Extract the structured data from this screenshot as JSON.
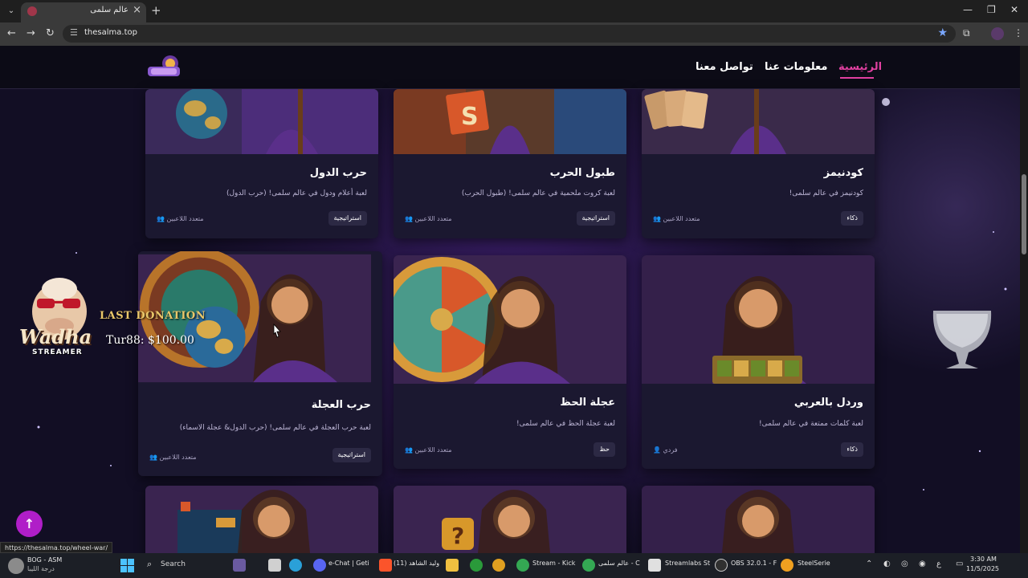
{
  "browser": {
    "tab_title": "عالم سلمى",
    "url": "thesalma.top",
    "status_url": "https://thesalma.top/wheel-war/"
  },
  "site": {
    "nav": {
      "home": "الرئيسية",
      "about": "معلومات عنا",
      "contact": "تواصل معنا"
    }
  },
  "cards": [
    {
      "title": "حرب الدول",
      "desc": "لعبة أعلام ودول في عالم سلمى! (حرب الدول)",
      "badge": "استراتيجية",
      "players": "متعدد اللاعبين"
    },
    {
      "title": "طبول الحرب",
      "desc": "لعبة كروت ملحمية في عالم سلمى! (طبول الحرب)",
      "badge": "استراتيجية",
      "players": "متعدد اللاعبين"
    },
    {
      "title": "كودنيمز",
      "desc": "كودنيمز في عالم سلمى!",
      "badge": "ذكاء",
      "players": "متعدد اللاعبين"
    },
    {
      "title": "حرب العجلة",
      "desc": "لعبة حرب العجلة في عالم سلمى! (حرب الدول& عجلة الاسماء)",
      "badge": "استراتيجية",
      "players": "متعدد اللاعبين"
    },
    {
      "title": "عجلة الحظ",
      "desc": "لعبة عجلة الحظ في عالم سلمى!",
      "badge": "حظ",
      "players": "متعدد اللاعبين"
    },
    {
      "title": "وردل بالعربي",
      "desc": "لعبة كلمات ممتعة في عالم سلمى!",
      "badge": "ذكاء",
      "players": "فردي"
    }
  ],
  "overlay": {
    "wadha": "Wadha",
    "streamer": "STREAMER",
    "last_donation_label": "LAST DONATION",
    "last_donation_value": "Tur88: $100.00"
  },
  "taskbar": {
    "weather_line1": "BOG - ASM",
    "weather_line2": "درجة الليبا",
    "search": "Search",
    "items": [
      "e-Chat | Geti",
      "وليد الشاهد (11)",
      "Stream - Kick",
      "عالم سلمى - C",
      "Streamlabs St",
      "OBS 32.0.1 - F",
      "SteelSerie"
    ],
    "time": "3:30 AM",
    "date": "11/5/2025"
  },
  "colors": {
    "accent": "#e040a0",
    "to_top": "#b01ec8",
    "card_bg": "#1b1830",
    "donation_label": "#e9c76a"
  },
  "icons": {
    "back": "arrow-left",
    "forward": "arrow-right",
    "reload": "reload",
    "bookmark": "star",
    "players": "users",
    "solo": "user",
    "to_top": "arrow-up"
  }
}
